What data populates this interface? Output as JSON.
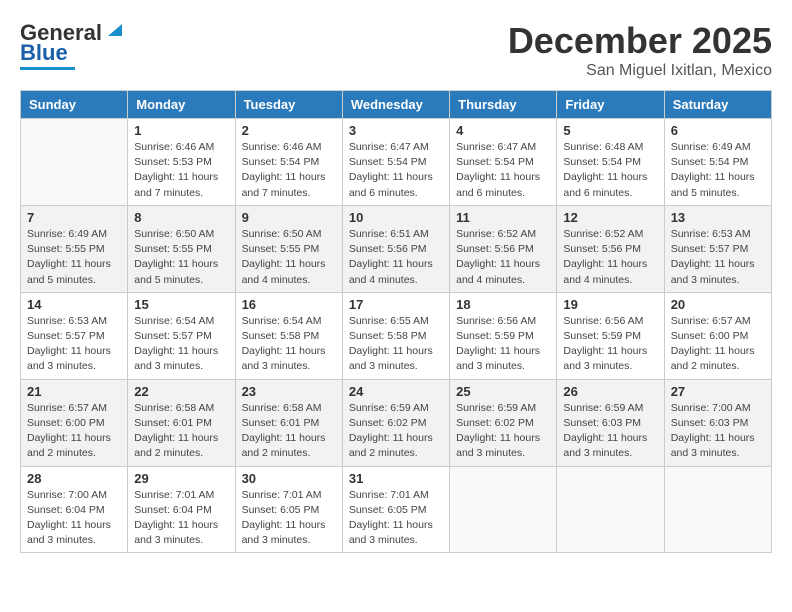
{
  "header": {
    "logo_general": "General",
    "logo_blue": "Blue",
    "month": "December 2025",
    "location": "San Miguel Ixitlan, Mexico"
  },
  "weekdays": [
    "Sunday",
    "Monday",
    "Tuesday",
    "Wednesday",
    "Thursday",
    "Friday",
    "Saturday"
  ],
  "weeks": [
    [
      {
        "day": "",
        "info": ""
      },
      {
        "day": "1",
        "info": "Sunrise: 6:46 AM\nSunset: 5:53 PM\nDaylight: 11 hours\nand 7 minutes."
      },
      {
        "day": "2",
        "info": "Sunrise: 6:46 AM\nSunset: 5:54 PM\nDaylight: 11 hours\nand 7 minutes."
      },
      {
        "day": "3",
        "info": "Sunrise: 6:47 AM\nSunset: 5:54 PM\nDaylight: 11 hours\nand 6 minutes."
      },
      {
        "day": "4",
        "info": "Sunrise: 6:47 AM\nSunset: 5:54 PM\nDaylight: 11 hours\nand 6 minutes."
      },
      {
        "day": "5",
        "info": "Sunrise: 6:48 AM\nSunset: 5:54 PM\nDaylight: 11 hours\nand 6 minutes."
      },
      {
        "day": "6",
        "info": "Sunrise: 6:49 AM\nSunset: 5:54 PM\nDaylight: 11 hours\nand 5 minutes."
      }
    ],
    [
      {
        "day": "7",
        "info": "Sunrise: 6:49 AM\nSunset: 5:55 PM\nDaylight: 11 hours\nand 5 minutes."
      },
      {
        "day": "8",
        "info": "Sunrise: 6:50 AM\nSunset: 5:55 PM\nDaylight: 11 hours\nand 5 minutes."
      },
      {
        "day": "9",
        "info": "Sunrise: 6:50 AM\nSunset: 5:55 PM\nDaylight: 11 hours\nand 4 minutes."
      },
      {
        "day": "10",
        "info": "Sunrise: 6:51 AM\nSunset: 5:56 PM\nDaylight: 11 hours\nand 4 minutes."
      },
      {
        "day": "11",
        "info": "Sunrise: 6:52 AM\nSunset: 5:56 PM\nDaylight: 11 hours\nand 4 minutes."
      },
      {
        "day": "12",
        "info": "Sunrise: 6:52 AM\nSunset: 5:56 PM\nDaylight: 11 hours\nand 4 minutes."
      },
      {
        "day": "13",
        "info": "Sunrise: 6:53 AM\nSunset: 5:57 PM\nDaylight: 11 hours\nand 3 minutes."
      }
    ],
    [
      {
        "day": "14",
        "info": "Sunrise: 6:53 AM\nSunset: 5:57 PM\nDaylight: 11 hours\nand 3 minutes."
      },
      {
        "day": "15",
        "info": "Sunrise: 6:54 AM\nSunset: 5:57 PM\nDaylight: 11 hours\nand 3 minutes."
      },
      {
        "day": "16",
        "info": "Sunrise: 6:54 AM\nSunset: 5:58 PM\nDaylight: 11 hours\nand 3 minutes."
      },
      {
        "day": "17",
        "info": "Sunrise: 6:55 AM\nSunset: 5:58 PM\nDaylight: 11 hours\nand 3 minutes."
      },
      {
        "day": "18",
        "info": "Sunrise: 6:56 AM\nSunset: 5:59 PM\nDaylight: 11 hours\nand 3 minutes."
      },
      {
        "day": "19",
        "info": "Sunrise: 6:56 AM\nSunset: 5:59 PM\nDaylight: 11 hours\nand 3 minutes."
      },
      {
        "day": "20",
        "info": "Sunrise: 6:57 AM\nSunset: 6:00 PM\nDaylight: 11 hours\nand 2 minutes."
      }
    ],
    [
      {
        "day": "21",
        "info": "Sunrise: 6:57 AM\nSunset: 6:00 PM\nDaylight: 11 hours\nand 2 minutes."
      },
      {
        "day": "22",
        "info": "Sunrise: 6:58 AM\nSunset: 6:01 PM\nDaylight: 11 hours\nand 2 minutes."
      },
      {
        "day": "23",
        "info": "Sunrise: 6:58 AM\nSunset: 6:01 PM\nDaylight: 11 hours\nand 2 minutes."
      },
      {
        "day": "24",
        "info": "Sunrise: 6:59 AM\nSunset: 6:02 PM\nDaylight: 11 hours\nand 2 minutes."
      },
      {
        "day": "25",
        "info": "Sunrise: 6:59 AM\nSunset: 6:02 PM\nDaylight: 11 hours\nand 3 minutes."
      },
      {
        "day": "26",
        "info": "Sunrise: 6:59 AM\nSunset: 6:03 PM\nDaylight: 11 hours\nand 3 minutes."
      },
      {
        "day": "27",
        "info": "Sunrise: 7:00 AM\nSunset: 6:03 PM\nDaylight: 11 hours\nand 3 minutes."
      }
    ],
    [
      {
        "day": "28",
        "info": "Sunrise: 7:00 AM\nSunset: 6:04 PM\nDaylight: 11 hours\nand 3 minutes."
      },
      {
        "day": "29",
        "info": "Sunrise: 7:01 AM\nSunset: 6:04 PM\nDaylight: 11 hours\nand 3 minutes."
      },
      {
        "day": "30",
        "info": "Sunrise: 7:01 AM\nSunset: 6:05 PM\nDaylight: 11 hours\nand 3 minutes."
      },
      {
        "day": "31",
        "info": "Sunrise: 7:01 AM\nSunset: 6:05 PM\nDaylight: 11 hours\nand 3 minutes."
      },
      {
        "day": "",
        "info": ""
      },
      {
        "day": "",
        "info": ""
      },
      {
        "day": "",
        "info": ""
      }
    ]
  ]
}
